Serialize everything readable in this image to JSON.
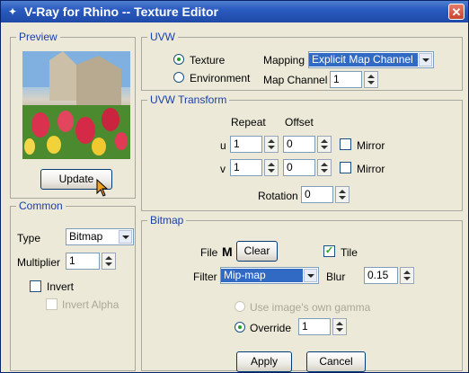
{
  "window": {
    "title": "V-Ray for Rhino -- Texture Editor"
  },
  "preview": {
    "legend": "Preview",
    "update_label": "Update"
  },
  "common": {
    "legend": "Common",
    "type_label": "Type",
    "type_value": "Bitmap",
    "multiplier_label": "Multiplier",
    "multiplier_value": "1",
    "invert_label": "Invert",
    "invert_alpha_label": "Invert Alpha"
  },
  "uvw": {
    "legend": "UVW",
    "texture_label": "Texture",
    "environment_label": "Environment",
    "mapping_label": "Mapping",
    "mapping_value": "Explicit Map Channel",
    "map_channel_label": "Map Channel",
    "map_channel_value": "1"
  },
  "uvw_transform": {
    "legend": "UVW Transform",
    "repeat_label": "Repeat",
    "offset_label": "Offset",
    "u_label": "u",
    "u_repeat": "1",
    "u_offset": "0",
    "v_label": "v",
    "v_repeat": "1",
    "v_offset": "0",
    "mirror_label": "Mirror",
    "rotation_label": "Rotation",
    "rotation_value": "0"
  },
  "bitmap": {
    "legend": "Bitmap",
    "file_label": "File",
    "m_label": "M",
    "clear_label": "Clear",
    "tile_label": "Tile",
    "filter_label": "Filter",
    "filter_value": "Mip-map",
    "blur_label": "Blur",
    "blur_value": "0.15",
    "use_gamma_label": "Use image's own gamma",
    "override_label": "Override",
    "override_value": "1"
  },
  "footer": {
    "apply_label": "Apply",
    "cancel_label": "Cancel"
  }
}
